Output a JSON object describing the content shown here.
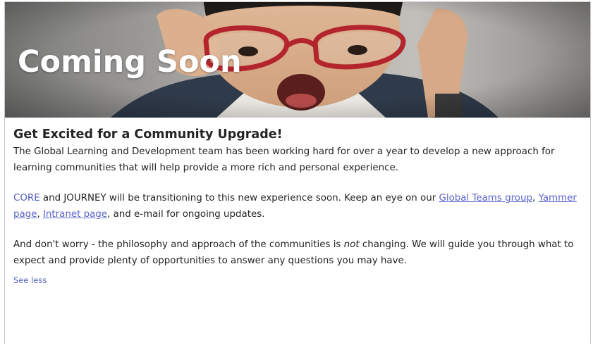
{
  "hero": {
    "title": "Coming Soon"
  },
  "article": {
    "heading": "Get Excited for a Community Upgrade!",
    "paragraph1": "The Global Learning and Development team has been working hard for over a year to develop a new approach for learning communities that will help provide a more rich and personal experience.",
    "paragraph2": {
      "core": "CORE",
      "text_a": " and JOURNEY will be transitioning to this new experience soon. Keep an eye on our ",
      "link_teams": "Global Teams group",
      "sep1": ", ",
      "link_yammer": "Yammer page",
      "sep2": ", ",
      "link_intranet": "Intranet page",
      "text_b": ", and e-mail for ongoing updates."
    },
    "paragraph3": {
      "text_a": "And don't worry - the philosophy and approach of the communities is ",
      "emphasis": "not",
      "text_b": " changing. We will guide you through what to expect and provide plenty of opportunities to answer any questions you may have."
    },
    "see_less": "See less"
  },
  "colors": {
    "link": "#5b63c9",
    "accent": "#4f5dbf",
    "text": "#252423",
    "glasses": "#b3242c"
  }
}
